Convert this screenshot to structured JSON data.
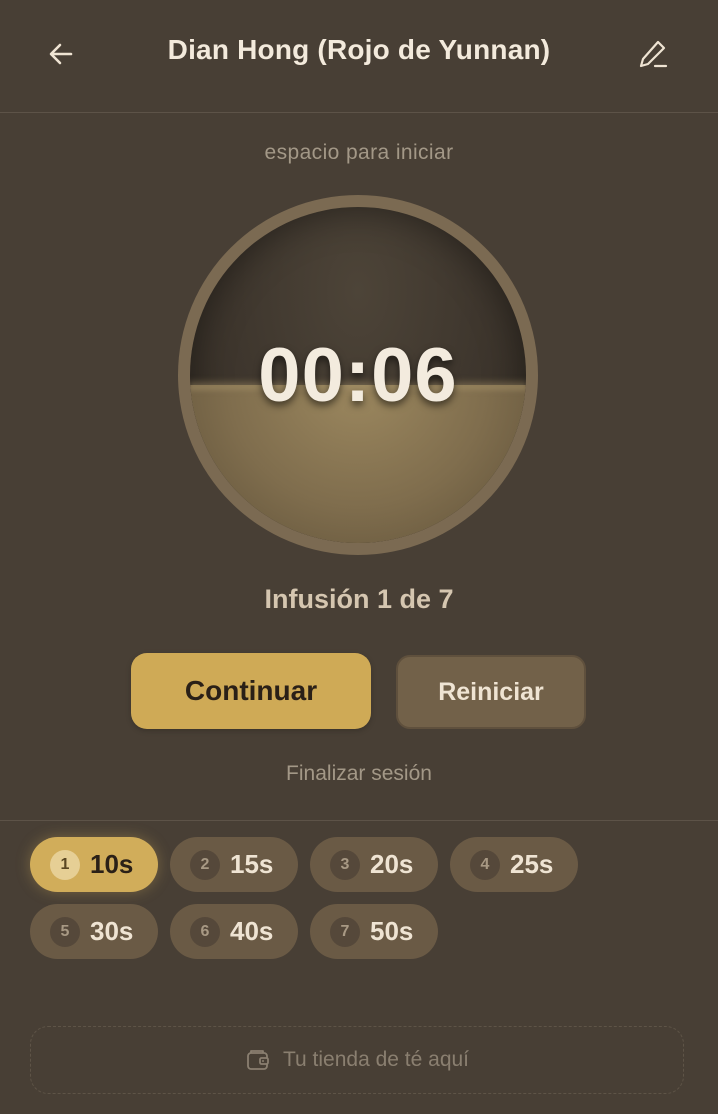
{
  "header": {
    "title": "Dian Hong (Rojo de Yunnan)",
    "back_icon": "arrow-left-icon",
    "edit_icon": "pencil-icon"
  },
  "timer": {
    "hint": "espacio para iniciar",
    "time": "00:06",
    "infusion_label": "Infusión 1 de 7",
    "fill_fraction": 0.47
  },
  "actions": {
    "continue_label": "Continuar",
    "reset_label": "Reiniciar",
    "end_session_label": "Finalizar sesión"
  },
  "steeps": [
    {
      "num": "1",
      "time": "10s",
      "active": true
    },
    {
      "num": "2",
      "time": "15s",
      "active": false
    },
    {
      "num": "3",
      "time": "20s",
      "active": false
    },
    {
      "num": "4",
      "time": "25s",
      "active": false
    },
    {
      "num": "5",
      "time": "30s",
      "active": false
    },
    {
      "num": "6",
      "time": "40s",
      "active": false
    },
    {
      "num": "7",
      "time": "50s",
      "active": false
    }
  ],
  "shop": {
    "label": "Tu tienda de té aquí",
    "icon": "wallet-icon"
  },
  "colors": {
    "background": "#483f35",
    "accent": "#d1ad5a",
    "secondary_button": "#726149"
  }
}
